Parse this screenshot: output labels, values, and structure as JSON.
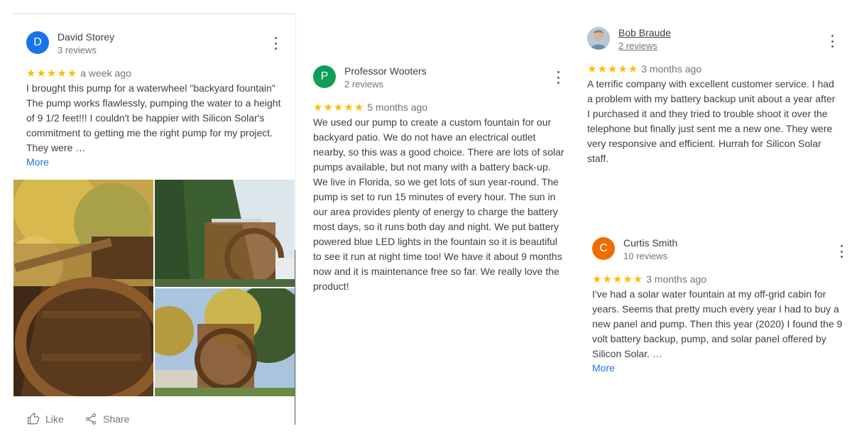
{
  "reviews": [
    {
      "avatar_letter": "D",
      "avatar_color": "#1a73e8",
      "name": "David Storey",
      "reviews_count": "3 reviews",
      "stars": "★★★★★",
      "date": "a week ago",
      "text": "I brought this pump for a waterwheel \"backyard fountain\" The pump works flawlessly, pumping the water to a height of 9 1/2 feet!!! I couldn't be happier with Silicon Solar's commitment to getting me the right pump for my project. They were …",
      "more": "More",
      "like_label": "Like",
      "share_label": "Share"
    },
    {
      "avatar_letter": "P",
      "avatar_color": "#0f9d58",
      "name": "Professor Wooters",
      "reviews_count": "2 reviews",
      "stars": "★★★★★",
      "date": "5 months ago",
      "text": "We used our pump to create a custom fountain for our backyard patio.  We do not have an electrical outlet nearby, so this was a good choice.  There are lots of solar pumps available, but not many with a battery back-up.  We live in Florida, so we get lots of sun year-round.  The pump is set to run 15 minutes of every hour.  The sun in our area provides plenty of energy to charge the battery most days, so it runs both day and night.  We put battery powered blue LED lights in the fountain so it is beautiful to see it run at night time too!  We have it about 9 months now and it is maintenance free so far.  We really love the product!"
    },
    {
      "name": "Bob Braude",
      "reviews_count": "2 reviews",
      "stars": "★★★★★",
      "date": "3 months ago",
      "text": "A terrific company with excellent customer service. I had a problem with my battery backup unit about a year after I purchased it and they tried to trouble shoot it over the telephone but finally just sent me a new one. They were very responsive and efficient. Hurrah for Silicon Solar staff."
    },
    {
      "avatar_letter": "C",
      "avatar_color": "#ef6c00",
      "name": "Curtis Smith",
      "reviews_count": "10 reviews",
      "stars": "★★★★★",
      "date": "3 months ago",
      "text": "I've had a solar water fountain at my off-grid cabin for years.  Seems that pretty much every year I had to buy a new panel and pump.  Then this year (2020) I found the 9 volt battery backup, pump, and solar panel offered by Silicon Solar. …",
      "more": "More"
    }
  ],
  "colors": {
    "star": "#fbbc04",
    "link": "#1a73e8"
  }
}
